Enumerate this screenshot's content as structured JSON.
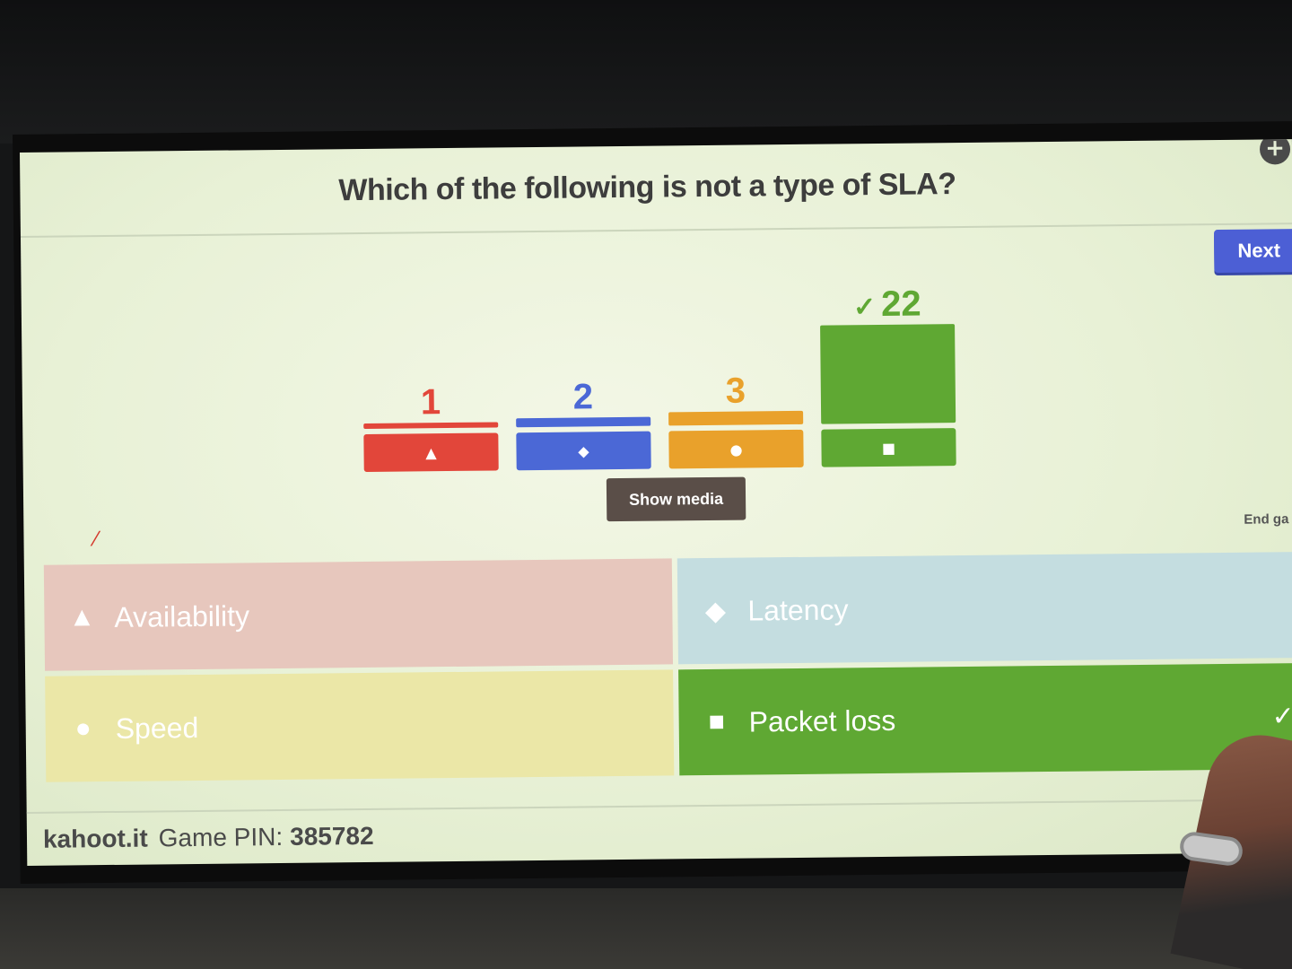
{
  "question": "Which of the following is not a type of SLA?",
  "controls": {
    "next_label": "Next",
    "end_game_label": "End ga",
    "show_media_label": "Show media"
  },
  "results": [
    {
      "shape": "triangle",
      "shape_glyph": "▲",
      "count": "1",
      "value": 1,
      "color": "#e2463a",
      "correct": false
    },
    {
      "shape": "diamond",
      "shape_glyph": "◆",
      "count": "2",
      "value": 2,
      "color": "#4b68d6",
      "correct": false
    },
    {
      "shape": "circle",
      "shape_glyph": "●",
      "count": "3",
      "value": 3,
      "color": "#e9a12b",
      "correct": false
    },
    {
      "shape": "square",
      "shape_glyph": "■",
      "count": "22",
      "value": 22,
      "color": "#5fa833",
      "correct": true
    }
  ],
  "check_glyph": "✓",
  "answers": [
    {
      "label": "Availability",
      "shape_glyph": "▲",
      "color": "#e7c7bd",
      "correct": false
    },
    {
      "label": "Latency",
      "shape_glyph": "◆",
      "color": "#c4dde0",
      "correct": false
    },
    {
      "label": "Speed",
      "shape_glyph": "●",
      "color": "#ebe7a7",
      "correct": false
    },
    {
      "label": "Packet loss",
      "shape_glyph": "■",
      "color": "#5fa833",
      "correct": true
    }
  ],
  "footer": {
    "brand": "kahoot.it",
    "pin_label": "Game PIN:",
    "pin": "385782"
  }
}
